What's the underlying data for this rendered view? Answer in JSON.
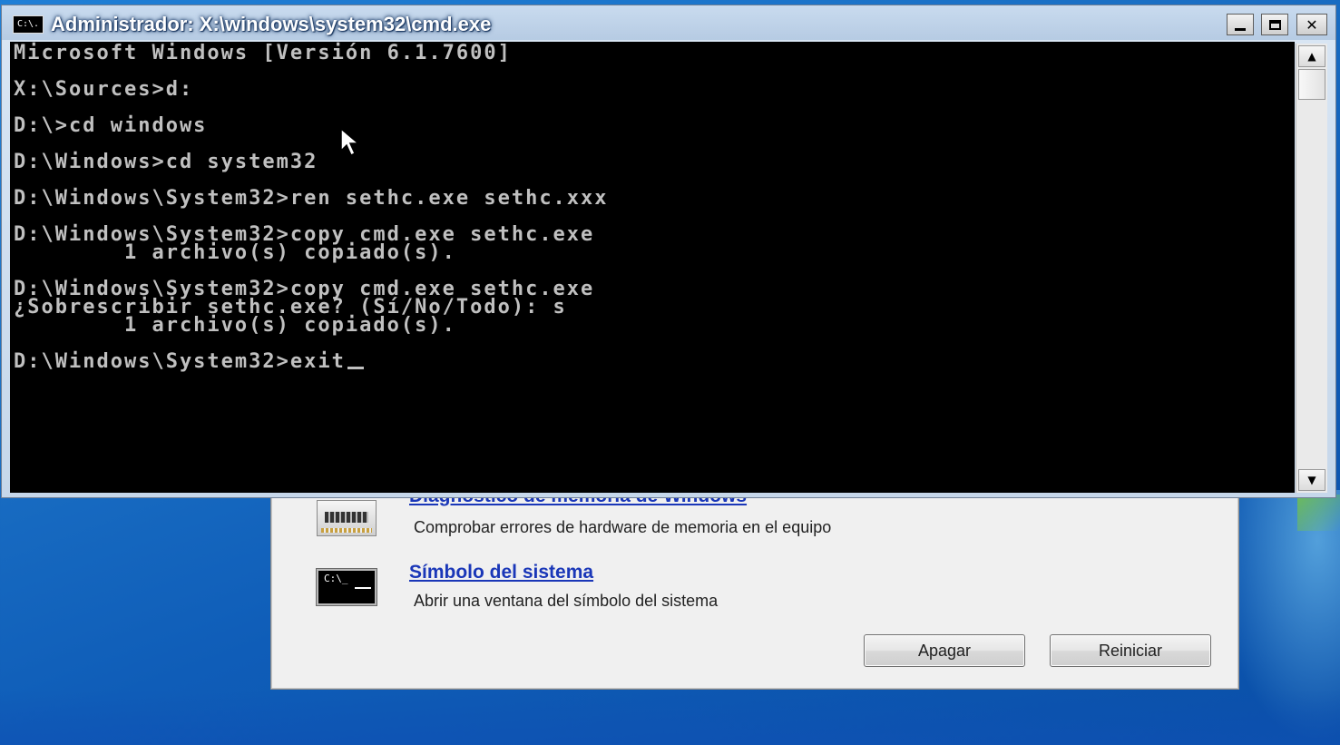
{
  "cmd_window": {
    "title": "Administrador: X:\\windows\\system32\\cmd.exe",
    "icon_label": "C:\\.",
    "controls": {
      "minimize": "",
      "maximize": "",
      "close": "✕"
    },
    "console_lines": [
      "Microsoft Windows [Versión 6.1.7600]",
      "",
      "X:\\Sources>d:",
      "",
      "D:\\>cd windows",
      "",
      "D:\\Windows>cd system32",
      "",
      "D:\\Windows\\System32>ren sethc.exe sethc.xxx",
      "",
      "D:\\Windows\\System32>copy cmd.exe sethc.exe",
      "        1 archivo(s) copiado(s).",
      "",
      "D:\\Windows\\System32>copy cmd.exe sethc.exe",
      "¿Sobrescribir sethc.exe? (Sí/No/Todo): s",
      "        1 archivo(s) copiado(s).",
      "",
      "D:\\Windows\\System32>exit"
    ],
    "scroll": {
      "up": "▲",
      "down": "▼"
    }
  },
  "recovery": {
    "tools": [
      {
        "name": "Diagnóstico de memoria de Windows",
        "description": "Comprobar errores de hardware de memoria en el equipo"
      },
      {
        "name": "Símbolo del sistema",
        "description": "Abrir una ventana del símbolo del sistema",
        "icon_label": "C:\\_"
      }
    ],
    "buttons": {
      "shutdown": "Apagar",
      "restart": "Reiniciar"
    }
  }
}
